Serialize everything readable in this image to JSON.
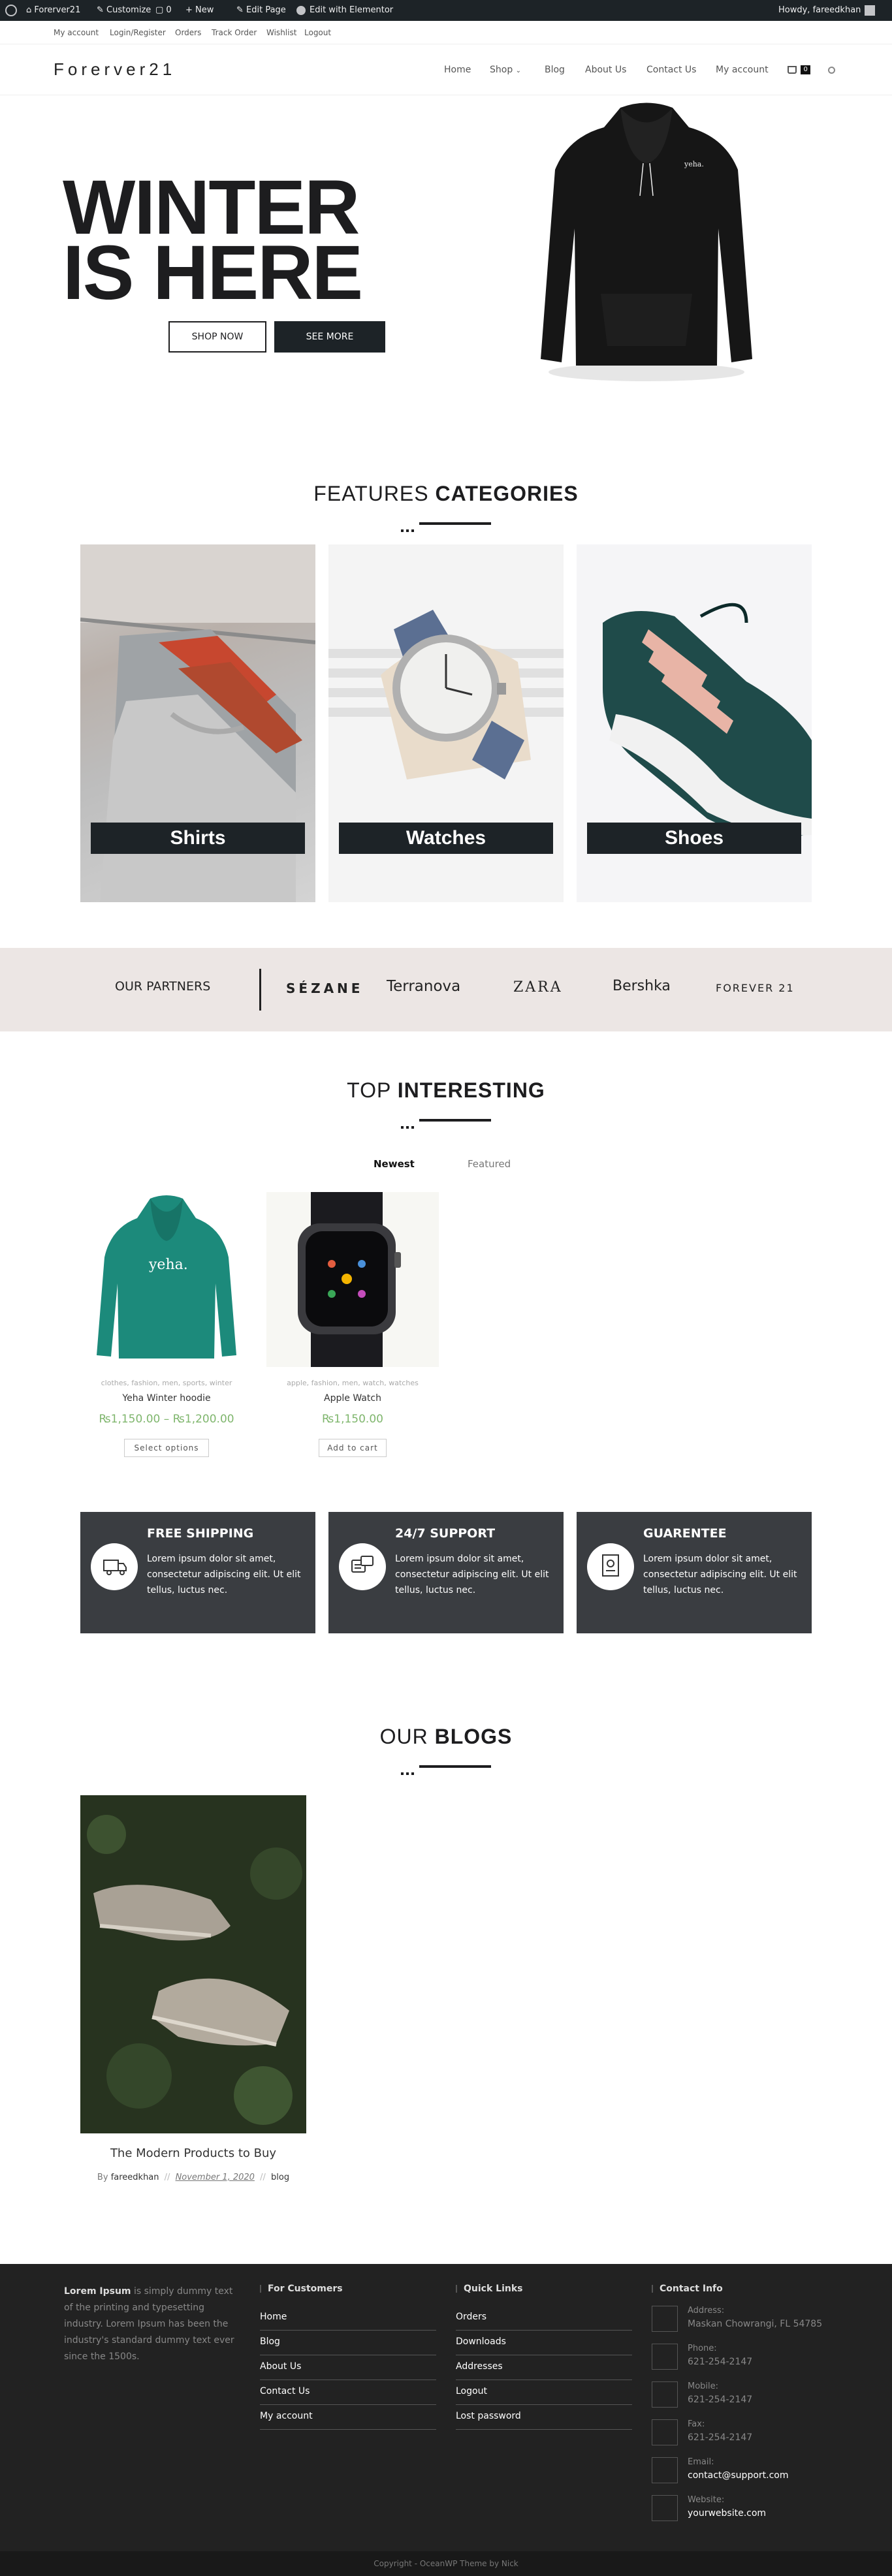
{
  "adminbar": {
    "site": "Forerver21",
    "customize": "Customize",
    "comments": "0",
    "new": "New",
    "edit_page": "Edit Page",
    "edit_elementor": "Edit with Elementor",
    "howdy": "Howdy, fareedkhan"
  },
  "topbar": {
    "links": [
      "My account",
      "Login/Register",
      "Orders",
      "Track Order",
      "Wishlist",
      "Logout"
    ]
  },
  "header": {
    "logo": "Forerver21",
    "nav": [
      "Home",
      "Shop",
      "Blog",
      "About Us",
      "Contact Us",
      "My account"
    ],
    "cart_count": "0"
  },
  "hero": {
    "title_line1": "WINTER",
    "title_line2": "IS HERE",
    "shop_now": "SHOP NOW",
    "see_more": "SEE MORE",
    "hoodie_logo": "yeha."
  },
  "categories": {
    "title_light": "FEATURES ",
    "title_bold": "CATEGORIES",
    "items": [
      "Shirts",
      "Watches",
      "Shoes"
    ]
  },
  "partners": {
    "label": "OUR PARTNERS",
    "brands": [
      "SÉZANE",
      "Terranova",
      "ZARA",
      "Bershka",
      "FOREVER 21"
    ]
  },
  "interesting": {
    "title_light": "TOP ",
    "title_bold": "INTERESTING",
    "tabs": [
      "Newest",
      "Featured"
    ],
    "products": [
      {
        "cats": "clothes, fashion, men, sports, winter",
        "name": "Yeha Winter hoodie",
        "price": "₨1,150.00 – ₨1,200.00",
        "button": "Select options",
        "logo": "yeha."
      },
      {
        "cats": "apple, fashion, men, watch, watches",
        "name": "Apple Watch",
        "price": "₨1,150.00",
        "button": "Add to cart"
      }
    ]
  },
  "features": [
    {
      "title": "FREE SHIPPING",
      "text": "Lorem ipsum dolor sit amet, consectetur adipiscing elit. Ut elit tellus, luctus nec.",
      "icon": "truck-icon"
    },
    {
      "title": "24/7 SUPPORT",
      "text": "Lorem ipsum dolor sit amet, consectetur adipiscing elit. Ut elit tellus, luctus nec.",
      "icon": "support-chat-icon"
    },
    {
      "title": "GUARENTEE",
      "text": "Lorem ipsum dolor sit amet, consectetur adipiscing elit. Ut elit tellus, luctus nec.",
      "icon": "certificate-icon"
    }
  ],
  "blogs": {
    "title_light": "OUR ",
    "title_bold": "BLOGS",
    "post": {
      "title": "The Modern Products to Buy",
      "by": "By",
      "author": "fareedkhan",
      "date": "November 1, 2020",
      "category": "blog",
      "sep": "//"
    }
  },
  "footer": {
    "about_bold": "Lorem Ipsum",
    "about_text": " is simply dummy text of the printing and typesetting industry. Lorem Ipsum has been the industry's standard dummy text ever since the 1500s.",
    "customers_title": "For Customers",
    "customers": [
      "Home",
      "Blog",
      "About Us",
      "Contact Us",
      "My account"
    ],
    "quick_title": "Quick Links",
    "quick": [
      "Orders",
      "Downloads",
      "Addresses",
      "Logout",
      "Lost password"
    ],
    "contact_title": "Contact Info",
    "contact": [
      {
        "label": "Address:",
        "value": "Maskan Chowrangi, FL 54785"
      },
      {
        "label": "Phone:",
        "value": "621-254-2147"
      },
      {
        "label": "Mobile:",
        "value": "621-254-2147"
      },
      {
        "label": "Fax:",
        "value": "621-254-2147"
      },
      {
        "label": "Email:",
        "value": "contact@support.com"
      },
      {
        "label": "Website:",
        "value": "yourwebsite.com"
      }
    ],
    "copyright": "Copyright - OceanWP Theme by Nick"
  },
  "colors": {
    "dark": "#1d2327",
    "price_green": "#7fb66d",
    "partners_bg": "#ece6e4",
    "footer_bg": "#222222"
  }
}
